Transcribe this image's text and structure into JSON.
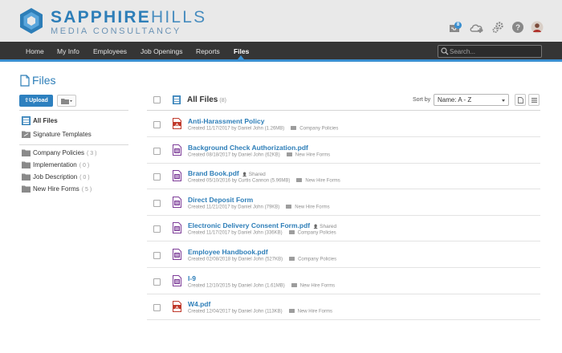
{
  "brand": {
    "name_strong": "SAPPHIRE",
    "name_light": "HILLS",
    "subtitle": "MEDIA CONSULTANCY",
    "logo_icon": "hexagon-logo-icon",
    "colors": {
      "primary": "#2d7eb8",
      "accent": "#3a8fd0",
      "nav_bg": "#353535",
      "header_bg": "#e9e9e9"
    }
  },
  "header_icons": {
    "inbox_badge": "8",
    "inbox_icon": "inbox-icon",
    "cloud_icon": "cloud-add-icon",
    "gear_icon": "gears-icon",
    "help_icon": "help-icon",
    "avatar_icon": "user-avatar"
  },
  "nav": {
    "items": [
      {
        "label": "Home"
      },
      {
        "label": "My Info"
      },
      {
        "label": "Employees"
      },
      {
        "label": "Job Openings"
      },
      {
        "label": "Reports"
      },
      {
        "label": "Files",
        "active": true
      }
    ],
    "search_placeholder": "Search..."
  },
  "left": {
    "title": "Files",
    "upload_label": "Upload",
    "folder_button_icon": "folder-dropdown-icon",
    "top_items": [
      {
        "label": "All Files",
        "icon": "all-files-icon"
      },
      {
        "label": "Signature Templates",
        "icon": "signature-folder-icon"
      }
    ],
    "folders": [
      {
        "label": "Company Policies",
        "count": "( 3 )"
      },
      {
        "label": "Implementation",
        "count": "( 0 )"
      },
      {
        "label": "Job Description",
        "count": "( 0 )"
      },
      {
        "label": "New Hire Forms",
        "count": "( 5 )"
      }
    ]
  },
  "right": {
    "title": "All Files",
    "count": "(8)",
    "sort_label": "Sort by",
    "sort_value": "Name: A - Z",
    "files": [
      {
        "name": "Anti-Harassment Policy",
        "shared": "",
        "meta": "Created 11/17/2017 by Daniel John (1.26MB)",
        "folder": "Company Policies",
        "type": "pdf"
      },
      {
        "name": "Background Check Authorization.pdf",
        "shared": "",
        "meta": "Created 08/18/2017 by Daniel John (62KB)",
        "folder": "New Hire Forms",
        "type": "form"
      },
      {
        "name": "Brand Book.pdf",
        "shared": "Shared",
        "meta": "Created 05/10/2016 by Curtis Cannon (5.96MB)",
        "folder": "New Hire Forms",
        "type": "form"
      },
      {
        "name": "Direct Deposit Form",
        "shared": "",
        "meta": "Created 11/21/2017 by Daniel John (79KB)",
        "folder": "New Hire Forms",
        "type": "form"
      },
      {
        "name": "Electronic Delivery Consent Form.pdf",
        "shared": "Shared",
        "meta": "Created 11/17/2017 by Daniel John (336KB)",
        "folder": "Company Policies",
        "type": "form"
      },
      {
        "name": "Employee Handbook.pdf",
        "shared": "",
        "meta": "Created 02/08/2018 by Daniel John (527KB)",
        "folder": "Company Policies",
        "type": "form"
      },
      {
        "name": "I-9",
        "shared": "",
        "meta": "Created 12/10/2015 by Daniel John (1.61MB)",
        "folder": "New Hire Forms",
        "type": "form"
      },
      {
        "name": "W4.pdf",
        "shared": "",
        "meta": "Created 12/04/2017 by Daniel John (113KB)",
        "folder": "New Hire Forms",
        "type": "pdf"
      }
    ]
  }
}
